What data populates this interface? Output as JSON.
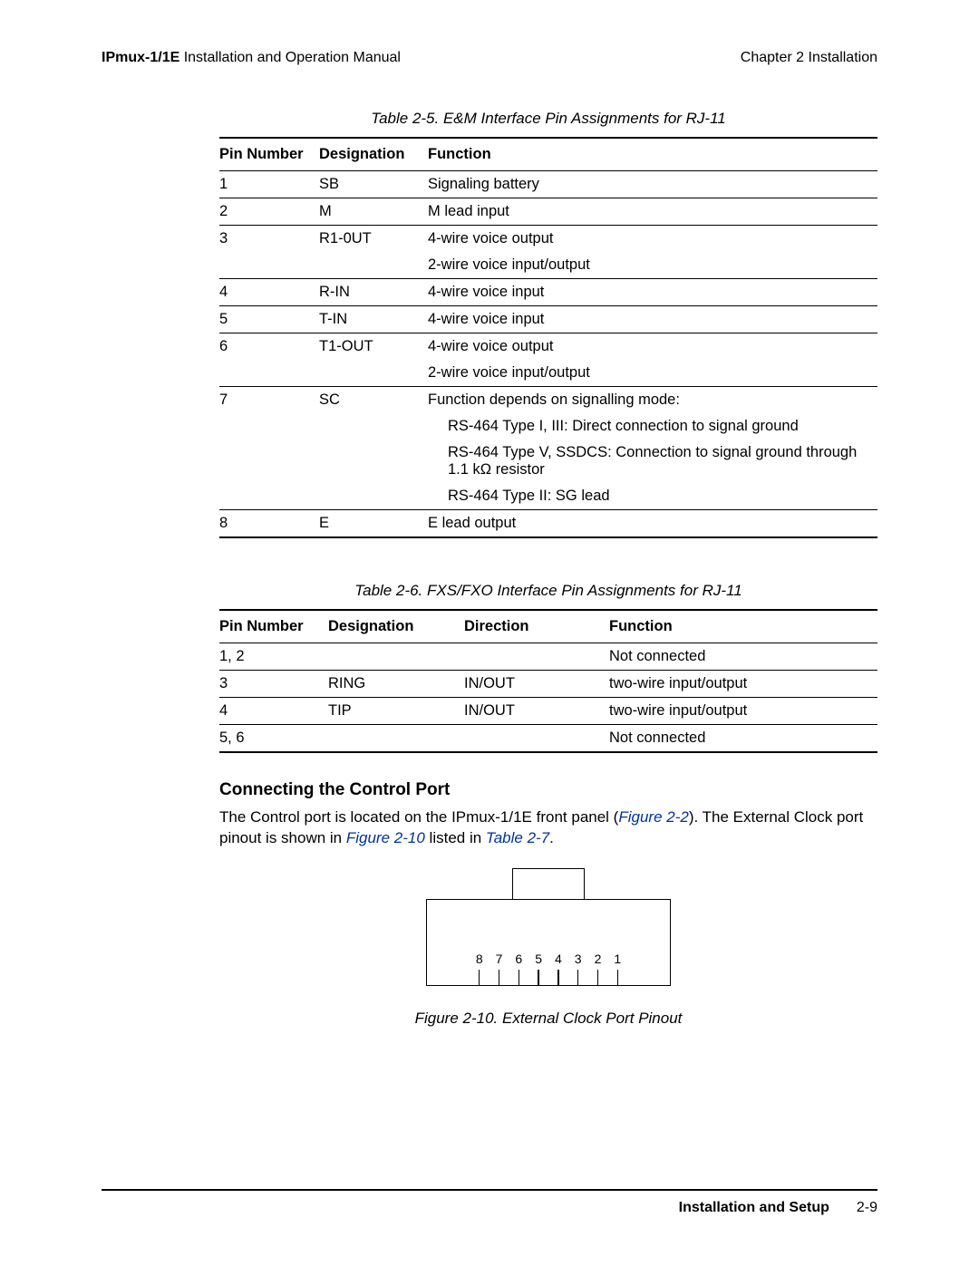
{
  "header": {
    "product": "IPmux-1/1E",
    "manual_name": " Installation and Operation Manual",
    "chapter": "Chapter 2  Installation"
  },
  "table5": {
    "caption": "Table 2-5.  E&M Interface Pin Assignments for RJ-11",
    "headers": {
      "pin": "Pin Number",
      "des": "Designation",
      "func": "Function"
    },
    "rows": [
      {
        "pin": "1",
        "des": "SB",
        "func": "Signaling battery"
      },
      {
        "pin": "2",
        "des": "M",
        "func": "M lead input"
      },
      {
        "pin": "3",
        "des": "R1-0UT",
        "func": "4-wire voice output",
        "func2": "2-wire voice input/output"
      },
      {
        "pin": "4",
        "des": "R-IN",
        "func": "4-wire voice input"
      },
      {
        "pin": "5",
        "des": "T-IN",
        "func": "4-wire voice input"
      },
      {
        "pin": "6",
        "des": "T1-OUT",
        "func": "4-wire voice output",
        "func2": "2-wire voice input/output"
      },
      {
        "pin": "7",
        "des": "SC",
        "func": "Function depends on signalling mode:",
        "subs": [
          "RS-464 Type I, III: Direct connection to signal ground",
          "RS-464 Type V, SSDCS: Connection to signal ground through 1.1 kΩ resistor",
          "RS-464 Type II: SG lead"
        ]
      },
      {
        "pin": "8",
        "des": "E",
        "func": "E lead output"
      }
    ]
  },
  "table6": {
    "caption": "Table 2-6.  FXS/FXO Interface Pin Assignments for RJ-11",
    "headers": {
      "pin": "Pin Number",
      "des": "Designation",
      "dir": "Direction",
      "func": "Function"
    },
    "rows": [
      {
        "pin": "1, 2",
        "des": "",
        "dir": "",
        "func": "Not connected"
      },
      {
        "pin": "3",
        "des": "RING",
        "dir": "IN/OUT",
        "func": "two-wire input/output"
      },
      {
        "pin": "4",
        "des": "TIP",
        "dir": "IN/OUT",
        "func": "two-wire input/output"
      },
      {
        "pin": "5, 6",
        "des": "",
        "dir": "",
        "func": "Not connected"
      }
    ]
  },
  "section": {
    "heading": "Connecting the Control Port",
    "para_pre": "The Control port is located on the IPmux-1/1E front panel (",
    "xref1": "Figure 2-2",
    "para_mid1": "). The External Clock port pinout is shown in ",
    "xref2": "Figure 2-10",
    "para_mid2": " listed in ",
    "xref3": "Table 2-7",
    "para_post": "."
  },
  "figure": {
    "caption": "Figure 2-10.  External Clock Port Pinout",
    "pins": [
      "8",
      "7",
      "6",
      "5",
      "4",
      "3",
      "2",
      "1"
    ]
  },
  "footer": {
    "title": "Installation and Setup",
    "page": "2-9"
  }
}
